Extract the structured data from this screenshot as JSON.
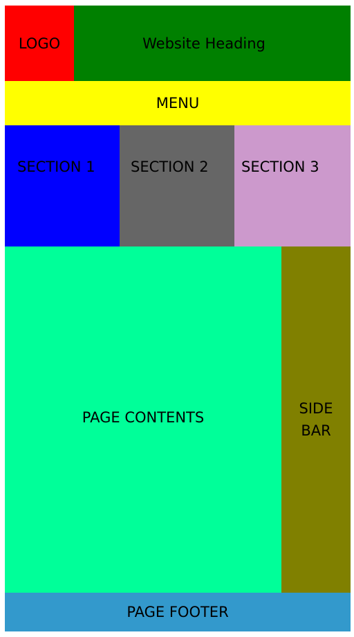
{
  "header": {
    "logo": "LOGO",
    "heading": "Website Heading",
    "logo_color": "#ff0000",
    "heading_color": "#008000"
  },
  "menu": {
    "label": "MENU",
    "color": "#ffff00"
  },
  "sections": [
    {
      "label": "SECTION 1",
      "color": "#0000ff"
    },
    {
      "label": "SECTION 2",
      "color": "#666666"
    },
    {
      "label": "SECTION 3",
      "color": "#cc99cc"
    }
  ],
  "main": {
    "label": "PAGE CONTENTS",
    "color": "#00ff99"
  },
  "sidebar": {
    "line1": "SIDE",
    "line2": "BAR",
    "color": "#808000"
  },
  "footer": {
    "label": "PAGE FOOTER",
    "color": "#3399cc"
  }
}
